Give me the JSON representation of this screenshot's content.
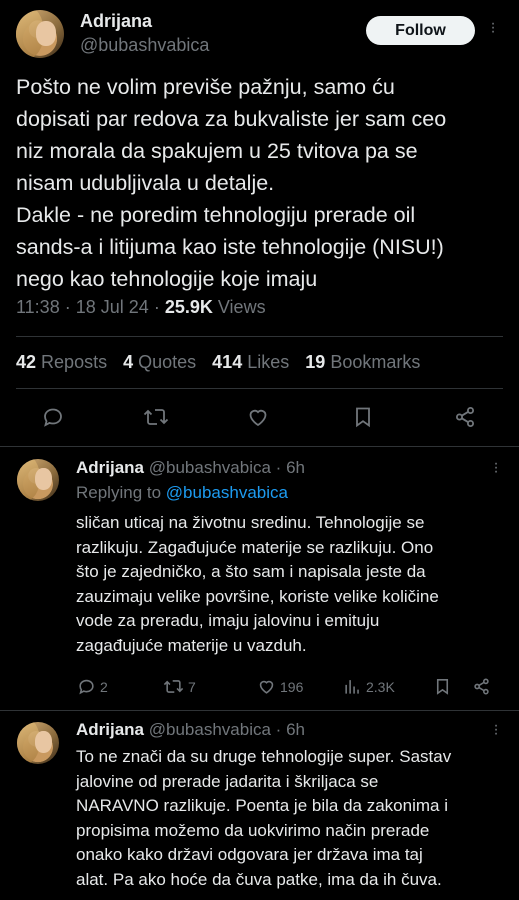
{
  "main_tweet": {
    "author_name": "Adrijana",
    "author_handle": "@bubashvabica",
    "follow_label": "Follow",
    "text": "Pošto ne volim previše pažnju, samo ću\ndopisati par redova za bukvaliste jer sam ceo\nniz morala da spakujem u 25 tvitova pa se\nnisam udubljivala u detalje.\nDakle - ne poredim tehnologiju prerade oil\nsands-a i litijuma kao iste tehnologije (NISU!)\nnego kao tehnologije koje imaju",
    "time": "11:38",
    "date": "18 Jul 24",
    "views_count": "25.9K",
    "views_label": "Views",
    "stats": [
      {
        "count": "42",
        "label": "Reposts"
      },
      {
        "count": "4",
        "label": "Quotes"
      },
      {
        "count": "414",
        "label": "Likes"
      },
      {
        "count": "19",
        "label": "Bookmarks"
      }
    ],
    "actions": [
      "reply-icon",
      "repost-icon",
      "like-icon",
      "bookmark-icon",
      "share-icon"
    ]
  },
  "replies": [
    {
      "author_name": "Adrijana",
      "author_handle": "@bubashvabica",
      "age": "6h",
      "replying_prefix": "Replying to",
      "replying_to": "@bubashvabica",
      "text": "sličan uticaj na životnu sredinu. Tehnologije se\nrazlikuju. Zagađujuće materije se razlikuju. Ono\nšto je zajedničko, a što sam i napisala jeste da\nzauzimaju velike površine, koriste velike količine\nvode za preradu, imaju jalovinu i emituju\nzagađujuće materije u vazduh.",
      "replies_count": "2",
      "reposts_count": "7",
      "likes_count": "196",
      "views_count": "2.3K"
    },
    {
      "author_name": "Adrijana",
      "author_handle": "@bubashvabica",
      "age": "6h",
      "text": "To ne znači da su druge tehnologije super. Sastav\njalovine od prerade jadarita i škriljaca se\nNARAVNO razlikuje. Poenta je bila da zakonima i\npropisima možemo da uokvirimo način prerade\nonako kako državi odgovara jer država ima taj\nalat. Pa ako hoće da čuva patke, ima da ih čuva."
    }
  ],
  "colors": {
    "background": "#000000",
    "text": "#e7e9ea",
    "muted": "#71767b",
    "link": "#1d9bf0",
    "divider": "#2f3336"
  }
}
